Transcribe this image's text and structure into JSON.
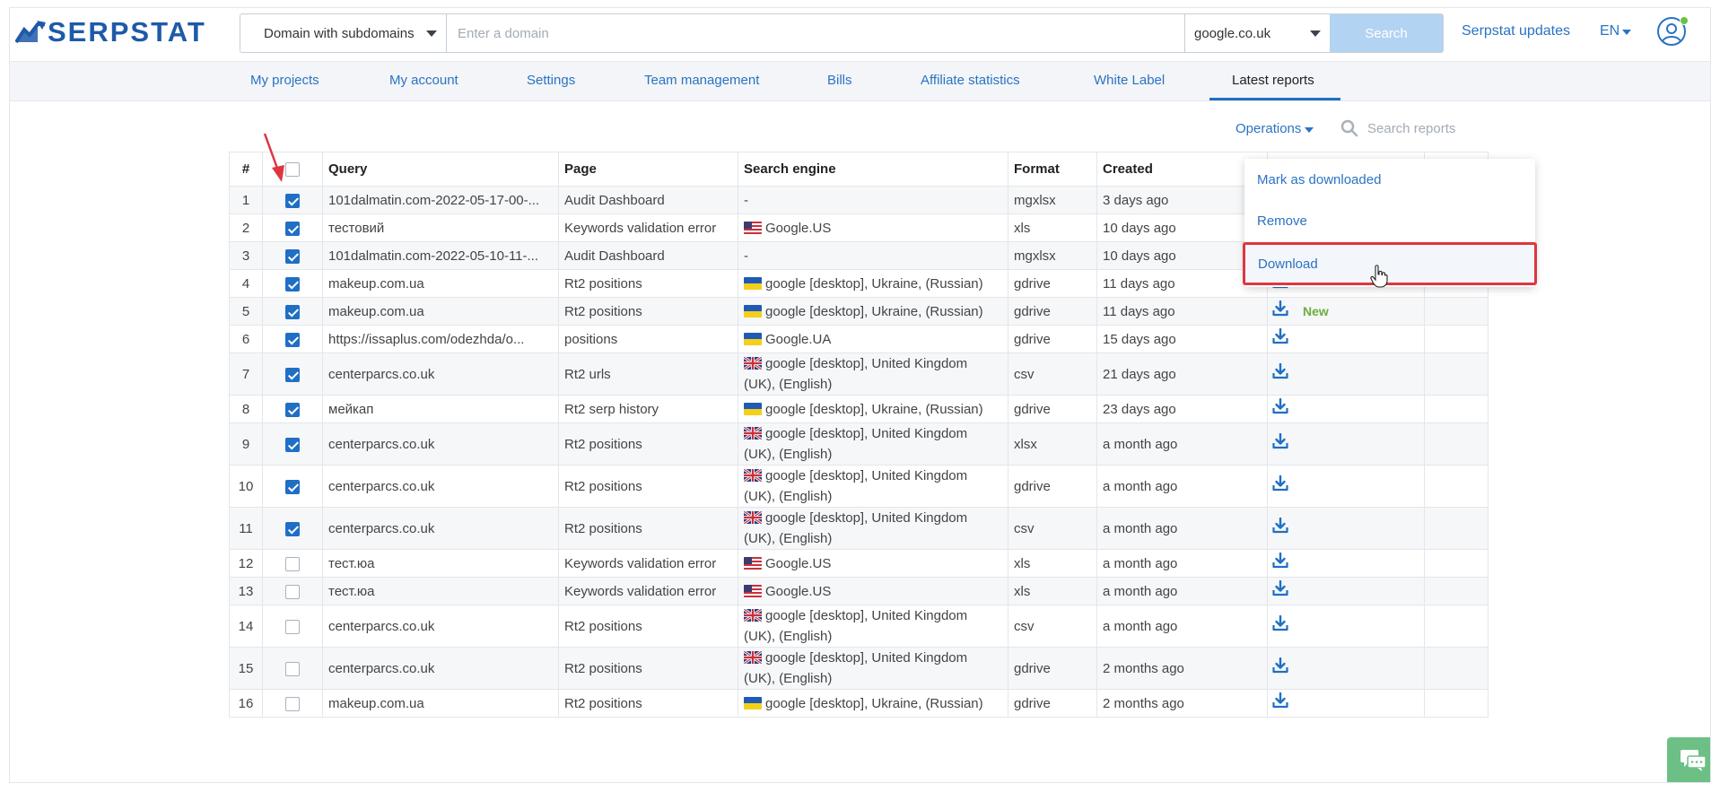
{
  "header": {
    "logo_text": "SERPSTAT",
    "scope_select": "Domain with subdomains",
    "domain_placeholder": "Enter a domain",
    "database_select": "google.co.uk",
    "search_label": "Search",
    "updates_link": "Serpstat updates",
    "language": "EN"
  },
  "nav": {
    "items": [
      {
        "label": "My projects"
      },
      {
        "label": "My account"
      },
      {
        "label": "Settings"
      },
      {
        "label": "Team management"
      },
      {
        "label": "Bills"
      },
      {
        "label": "Affiliate statistics"
      },
      {
        "label": "White Label"
      },
      {
        "label": "Latest reports"
      }
    ],
    "active": "Latest reports"
  },
  "toolbar": {
    "operations_label": "Operations",
    "search_placeholder": "Search reports"
  },
  "operations_menu": {
    "items": [
      {
        "label": "Mark as downloaded"
      },
      {
        "label": "Remove"
      },
      {
        "label": "Download",
        "highlighted": true
      }
    ]
  },
  "table": {
    "columns": [
      "#",
      "",
      "Query",
      "Page",
      "Search engine",
      "Format",
      "Created",
      "",
      ""
    ],
    "rows": [
      {
        "num": "1",
        "checked": true,
        "query": "101dalmatin.com-2022-05-17-00-...",
        "page": "Audit Dashboard",
        "flag": "",
        "engine": "-",
        "engine2": "",
        "format": "mgxlsx",
        "created": "3 days ago",
        "download": false,
        "badge": ""
      },
      {
        "num": "2",
        "checked": true,
        "query": "тестовий",
        "page": "Keywords validation error",
        "flag": "us",
        "engine": "Google.US",
        "engine2": "",
        "format": "xls",
        "created": "10 days ago",
        "download": false,
        "badge": ""
      },
      {
        "num": "3",
        "checked": true,
        "query": "101dalmatin.com-2022-05-10-11-...",
        "page": "Audit Dashboard",
        "flag": "",
        "engine": "-",
        "engine2": "",
        "format": "mgxlsx",
        "created": "10 days ago",
        "download": false,
        "badge": ""
      },
      {
        "num": "4",
        "checked": true,
        "query": "makeup.com.ua",
        "page": "Rt2 positions",
        "flag": "ua",
        "engine": "google [desktop], Ukraine, (Russian)",
        "engine2": "",
        "format": "gdrive",
        "created": "11 days ago",
        "download": true,
        "badge": ""
      },
      {
        "num": "5",
        "checked": true,
        "query": "makeup.com.ua",
        "page": "Rt2 positions",
        "flag": "ua",
        "engine": "google [desktop], Ukraine, (Russian)",
        "engine2": "",
        "format": "gdrive",
        "created": "11 days ago",
        "download": true,
        "badge": "New"
      },
      {
        "num": "6",
        "checked": true,
        "query": "https://issaplus.com/odezhda/o...",
        "page": "positions",
        "flag": "ua",
        "engine": "Google.UA",
        "engine2": "",
        "format": "gdrive",
        "created": "15 days ago",
        "download": true,
        "badge": ""
      },
      {
        "num": "7",
        "checked": true,
        "query": "centerparcs.co.uk",
        "page": "Rt2 urls",
        "flag": "uk",
        "engine": "google [desktop], United Kingdom",
        "engine2": "(UK), (English)",
        "format": "csv",
        "created": "21 days ago",
        "download": true,
        "badge": ""
      },
      {
        "num": "8",
        "checked": true,
        "query": "мейкап",
        "page": "Rt2 serp history",
        "flag": "ua",
        "engine": "google [desktop], Ukraine, (Russian)",
        "engine2": "",
        "format": "gdrive",
        "created": "23 days ago",
        "download": true,
        "badge": ""
      },
      {
        "num": "9",
        "checked": true,
        "query": "centerparcs.co.uk",
        "page": "Rt2 positions",
        "flag": "uk",
        "engine": "google [desktop], United Kingdom",
        "engine2": "(UK), (English)",
        "format": "xlsx",
        "created": "a month ago",
        "download": true,
        "badge": ""
      },
      {
        "num": "10",
        "checked": true,
        "query": "centerparcs.co.uk",
        "page": "Rt2 positions",
        "flag": "uk",
        "engine": "google [desktop], United Kingdom",
        "engine2": "(UK), (English)",
        "format": "gdrive",
        "created": "a month ago",
        "download": true,
        "badge": ""
      },
      {
        "num": "11",
        "checked": true,
        "query": "centerparcs.co.uk",
        "page": "Rt2 positions",
        "flag": "uk",
        "engine": "google [desktop], United Kingdom",
        "engine2": "(UK), (English)",
        "format": "csv",
        "created": "a month ago",
        "download": true,
        "badge": ""
      },
      {
        "num": "12",
        "checked": false,
        "query": "тест.юа",
        "page": "Keywords validation error",
        "flag": "us",
        "engine": "Google.US",
        "engine2": "",
        "format": "xls",
        "created": "a month ago",
        "download": true,
        "badge": ""
      },
      {
        "num": "13",
        "checked": false,
        "query": "тест.юа",
        "page": "Keywords validation error",
        "flag": "us",
        "engine": "Google.US",
        "engine2": "",
        "format": "xls",
        "created": "a month ago",
        "download": true,
        "badge": ""
      },
      {
        "num": "14",
        "checked": false,
        "query": "centerparcs.co.uk",
        "page": "Rt2 positions",
        "flag": "uk",
        "engine": "google [desktop], United Kingdom",
        "engine2": "(UK), (English)",
        "format": "csv",
        "created": "a month ago",
        "download": true,
        "badge": ""
      },
      {
        "num": "15",
        "checked": false,
        "query": "centerparcs.co.uk",
        "page": "Rt2 positions",
        "flag": "uk",
        "engine": "google [desktop], United Kingdom",
        "engine2": "(UK), (English)",
        "format": "gdrive",
        "created": "2 months ago",
        "download": true,
        "badge": ""
      },
      {
        "num": "16",
        "checked": false,
        "query": "makeup.com.ua",
        "page": "Rt2 positions",
        "flag": "ua",
        "engine": "google [desktop], Ukraine, (Russian)",
        "engine2": "",
        "format": "gdrive",
        "created": "2 months ago",
        "download": true,
        "badge": ""
      }
    ]
  },
  "colors": {
    "brand": "#1e5aa8",
    "link": "#2a73c3",
    "checkbox_on": "#1f6fc5",
    "badge_new": "#6cae3e",
    "highlight_border": "#e0353f"
  }
}
